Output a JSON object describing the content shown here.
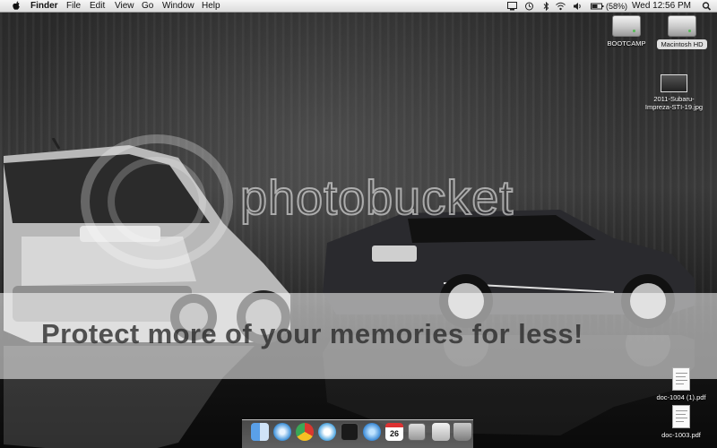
{
  "menubar": {
    "app_name": "Finder",
    "menus": [
      "File",
      "Edit",
      "View",
      "Go",
      "Window",
      "Help"
    ],
    "battery_percent": "(58%)",
    "clock": "Wed 12:56 PM",
    "status_icons": [
      "display-icon",
      "time-machine-icon",
      "bluetooth-icon",
      "wifi-icon",
      "volume-icon",
      "battery-icon",
      "spotlight-icon"
    ]
  },
  "desktop": {
    "icons": [
      {
        "label": "BOOTCAMP",
        "kind": "drive"
      },
      {
        "label": "Macintosh HD",
        "kind": "drive",
        "selected": true
      },
      {
        "label": "2011-Subaru-Impreza-STI-19.jpg",
        "label_line1": "2011-Subaru-",
        "label_line2": "Impreza-STI-19.jpg",
        "kind": "image"
      },
      {
        "label": "doc-1004 (1).pdf",
        "kind": "pdf"
      },
      {
        "label": "doc-1003.pdf",
        "kind": "pdf"
      }
    ]
  },
  "watermark": {
    "brand": "photobucket",
    "tagline": "Protect more of your memories for less!"
  },
  "dock": {
    "apps": [
      "finder-icon",
      "safari-icon",
      "chrome-icon",
      "itunes-icon",
      "blackberry-icon",
      "app-store-icon",
      "calendar-icon",
      "preview-icon",
      "mail-icon",
      "trash-icon"
    ],
    "calendar_day": "26"
  },
  "colors": {
    "menubar": "#e6e6e6",
    "selection_label": "#dfdfdf"
  }
}
